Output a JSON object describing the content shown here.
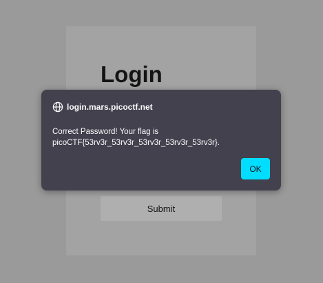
{
  "login": {
    "title": "Login",
    "submit_label": "Submit"
  },
  "dialog": {
    "origin": "login.mars.picoctf.net",
    "message_line1": "Correct Password! Your flag is",
    "message_line2": "picoCTF{53rv3r_53rv3r_53rv3r_53rv3r_53rv3r}.",
    "ok_label": "OK",
    "origin_icon": "globe-icon"
  },
  "colors": {
    "overlay": "#9a9a9a",
    "dialog_bg": "#42414d",
    "ok_accent": "#00ddff"
  }
}
